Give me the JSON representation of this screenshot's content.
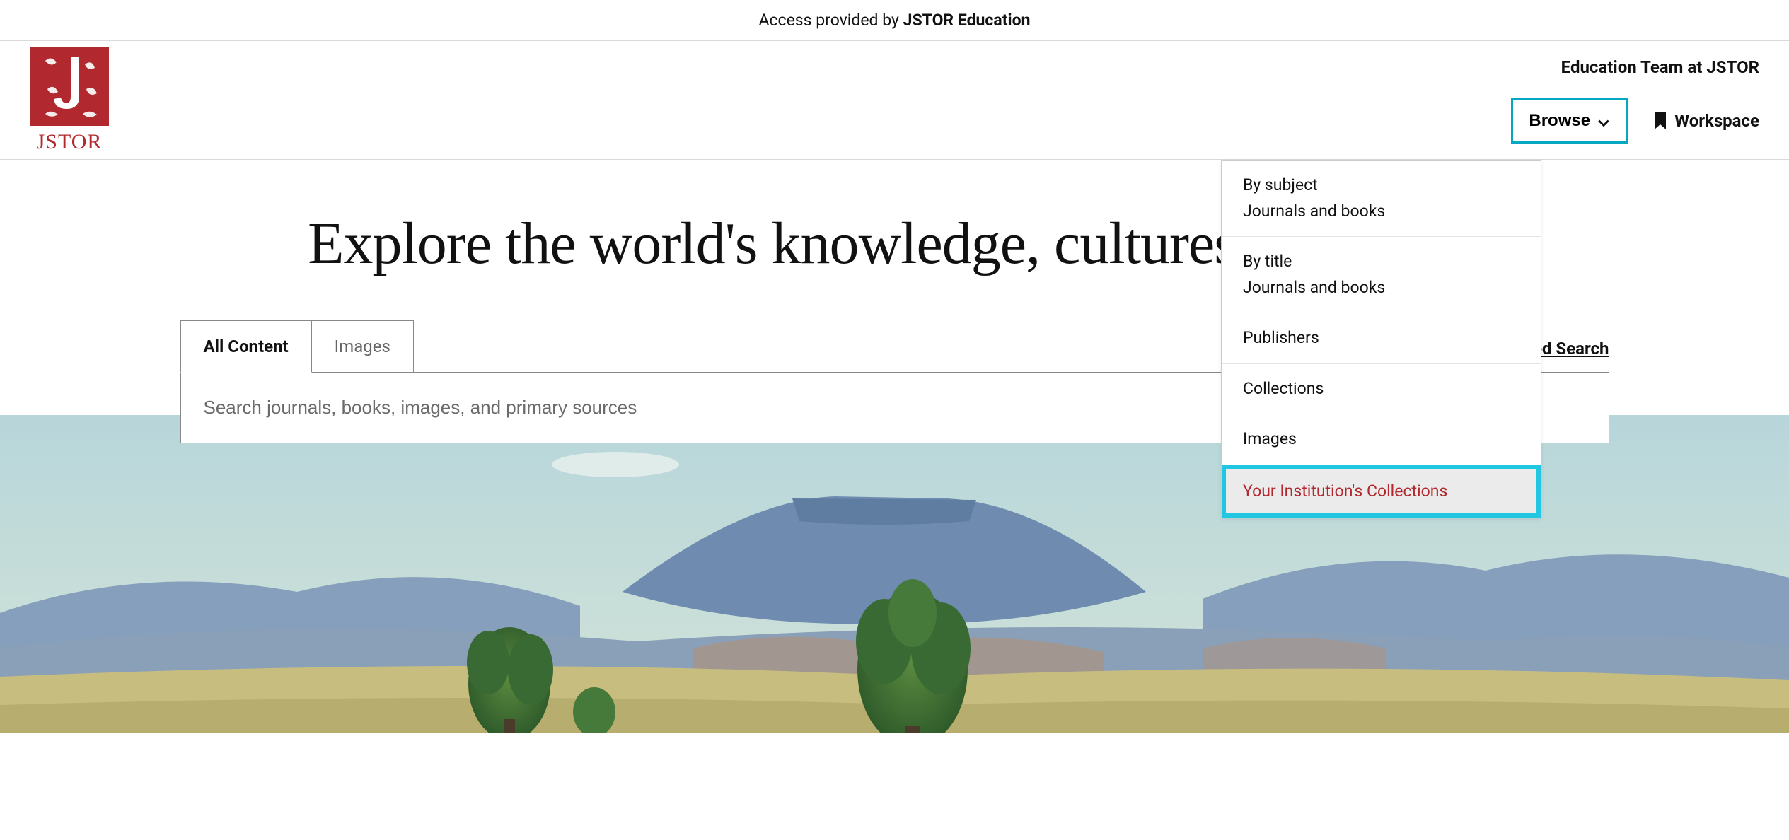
{
  "access_bar": {
    "prefix": "Access provided by ",
    "provider": "JSTOR Education"
  },
  "logo": {
    "text": "JSTOR"
  },
  "header": {
    "user_label": "Education Team at JSTOR",
    "browse_label": "Browse",
    "workspace_label": "Workspace"
  },
  "browse_dropdown": {
    "items": [
      {
        "title": "By subject",
        "subtitle": "Journals and books"
      },
      {
        "title": "By title",
        "subtitle": "Journals and books"
      },
      {
        "title": "Publishers"
      },
      {
        "title": "Collections"
      },
      {
        "title": "Images"
      },
      {
        "title": "Your Institution's Collections",
        "highlighted": true
      }
    ]
  },
  "hero": {
    "title": "Explore the world's knowledge, cultures, and ideas"
  },
  "search": {
    "tabs": [
      {
        "label": "All Content",
        "active": true
      },
      {
        "label": "Images",
        "active": false
      }
    ],
    "advanced_label": "Advanced Search",
    "placeholder": "Search journals, books, images, and primary sources"
  },
  "icons": {
    "chevron_down": "chevron-down-icon",
    "bookmark": "bookmark-icon"
  },
  "colors": {
    "brand_red": "#b1292e",
    "accent_cyan": "#06a7c1"
  }
}
